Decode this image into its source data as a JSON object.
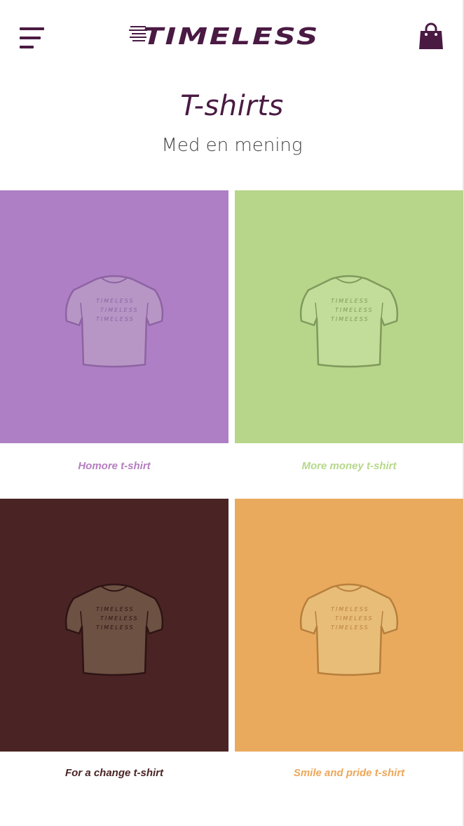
{
  "header": {
    "brand": "TIMELESS",
    "menu_icon": "hamburger-menu-icon",
    "cart_icon": "shopping-bag-icon"
  },
  "page": {
    "title": "T-shirts",
    "subtitle": "Med en mening"
  },
  "products": [
    {
      "name": "Homore t-shirt",
      "bg": "#ae7fc4",
      "shirt": "#b796c6",
      "line": "#8e63a3",
      "label_color": "#b57fbf",
      "print": "TIMELESS"
    },
    {
      "name": "More money t-shirt",
      "bg": "#b7d68a",
      "shirt": "#c2dc99",
      "line": "#7f9a5c",
      "label_color": "#b6d88a",
      "print": "TIMELESS"
    },
    {
      "name": "For a change t-shirt",
      "bg": "#4a2424",
      "shirt": "#6d5143",
      "line": "#2e1414",
      "label_color": "#4a2424",
      "print": "TIMELESS"
    },
    {
      "name": "Smile and pride t-shirt",
      "bg": "#eaaa5e",
      "shirt": "#e8bd78",
      "line": "#b77f3c",
      "label_color": "#eda75a",
      "print": "TIMELESS"
    }
  ],
  "colors": {
    "brand": "#4a1a43"
  }
}
